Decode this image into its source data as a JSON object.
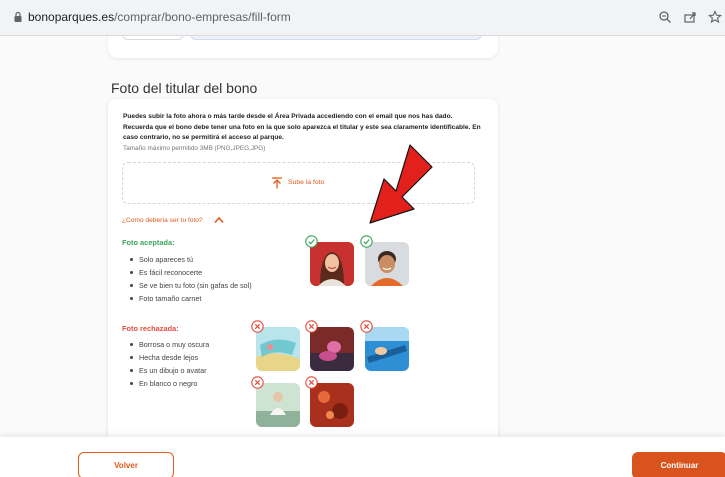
{
  "browser": {
    "url_host": "bonoparques.es",
    "url_path": "/comprar/bono-empresas/fill-form"
  },
  "section": {
    "title": "Foto del titular del bono"
  },
  "card": {
    "intro": "Puedes subir la foto ahora o más tarde desde el Área Privada accediendo con el email que nos has dado. Recuerda que el bono debe tener una foto en la que solo aparezca el titular y este sea claramente identificable. En caso contrario, no se permitirá el acceso al parque.",
    "max_size": "Tamaño máximo permitido 3MB (PNG,JPEG,JPG)",
    "upload_label": "Sube la foto",
    "howto_label": "¿Como debería ser tu foto?",
    "accepted": {
      "title": "Foto aceptada:",
      "items": [
        "Solo apareces tú",
        "Es fácil reconocerte",
        "Se ve bien tu foto (sin gafas de sol)",
        "Foto tamaño carnet"
      ]
    },
    "rejected": {
      "title": "Foto rechazada:",
      "items": [
        "Borrosa o muy oscura",
        "Hecha desde lejos",
        "Es un dibujo o avatar",
        "En blanco o negro"
      ]
    }
  },
  "footer": {
    "back_label": "Volver",
    "next_label": "Continuar"
  },
  "colors": {
    "accent": "#e05a1c",
    "accepted": "#3ba55d",
    "rejected": "#e74c3c",
    "arrow": "#e3211c"
  },
  "icons": [
    "lock-icon",
    "zoom-icon",
    "share-icon",
    "star-icon",
    "upload-icon",
    "chevron-up-icon",
    "check-circle-icon",
    "x-circle-icon",
    "red-arrow-annotation"
  ]
}
